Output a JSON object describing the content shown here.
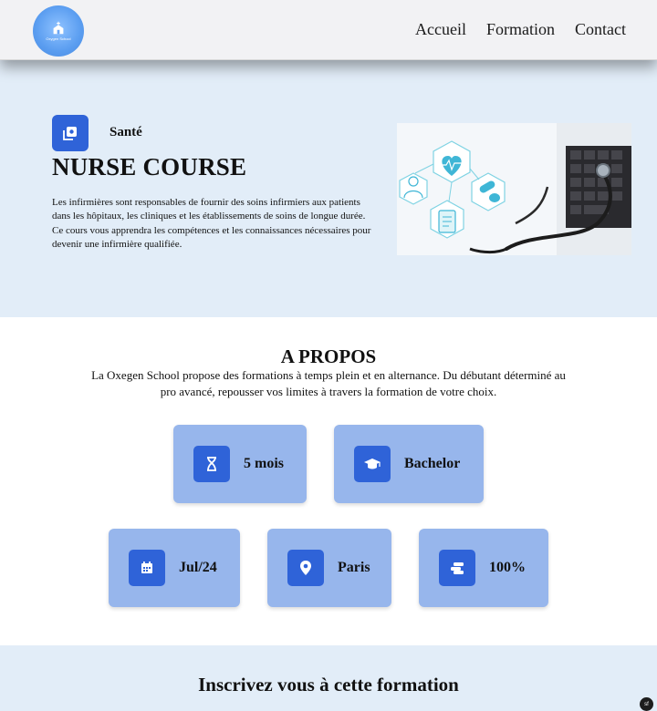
{
  "header": {
    "logo_text": "Oxygen School",
    "nav": [
      {
        "label": "Accueil"
      },
      {
        "label": "Formation"
      },
      {
        "label": "Contact"
      }
    ]
  },
  "hero": {
    "tag_icon": "copy-icon",
    "tag_label": "Santé",
    "title": "NURSE COURSE",
    "description": "Les infirmières sont responsables de fournir des soins infirmiers aux patients dans les hôpitaux, les cliniques et les établissements de soins de longue durée. Ce cours vous apprendra les compétences et les connaissances nécessaires pour devenir une infirmière qualifiée."
  },
  "about": {
    "title": "A PROPOS",
    "description": "La Oxegen School propose des formations à temps plein et en alternance. Du débutant déterminé au pro avancé, repousser vos limites à travers la formation de votre choix.",
    "cards": [
      {
        "icon": "hourglass-icon",
        "label": "5 mois"
      },
      {
        "icon": "graduation-cap-icon",
        "label": "Bachelor"
      },
      {
        "icon": "calendar-icon",
        "label": "Jul/24"
      },
      {
        "icon": "location-pin-icon",
        "label": "Paris"
      },
      {
        "icon": "coins-icon",
        "label": "100%"
      }
    ]
  },
  "signup": {
    "title": "Inscrivez vous à cette formation"
  },
  "corner_button": "sf",
  "colors": {
    "accent": "#2f63d8",
    "card": "#97b6ec",
    "band": "#e2edf8",
    "header": "#f2f2f4"
  }
}
